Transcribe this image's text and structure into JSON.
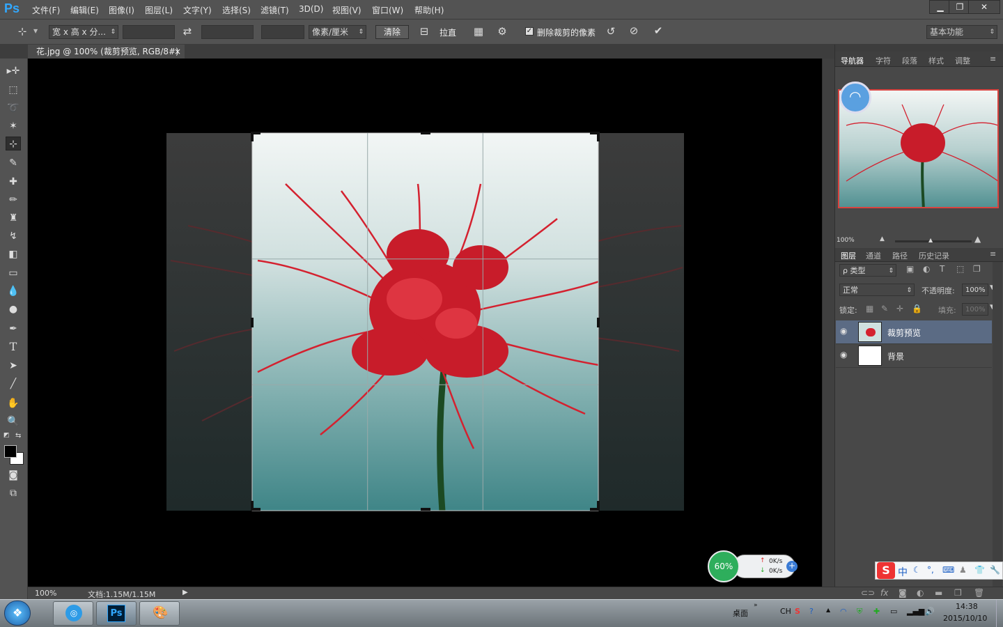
{
  "menubar": {
    "logo": "Ps",
    "items": [
      "文件(F)",
      "编辑(E)",
      "图像(I)",
      "图层(L)",
      "文字(Y)",
      "选择(S)",
      "滤镜(T)",
      "3D(D)",
      "视图(V)",
      "窗口(W)",
      "帮助(H)"
    ]
  },
  "optbar": {
    "ratio_select": "宽 x 高 x 分...",
    "unit_select": "像素/厘米",
    "clear_label": "清除",
    "straighten_label": "拉直",
    "delete_pixels_label": "删除裁剪的像素",
    "workspace": "基本功能"
  },
  "document": {
    "tab_title": "花.jpg @ 100% (裁剪预览, RGB/8#)",
    "close": "×"
  },
  "status": {
    "zoom": "100%",
    "doc_info": "文档:1.15M/1.15M"
  },
  "navigator": {
    "tabs": [
      "导航器",
      "字符",
      "段落",
      "样式",
      "调整"
    ],
    "zoom": "100%"
  },
  "layers_panel": {
    "tabs": [
      "图层",
      "通道",
      "路径",
      "历史记录"
    ],
    "kind": "ρ 类型",
    "blend_mode": "正常",
    "opacity_label": "不透明度:",
    "opacity": "100%",
    "lock_label": "锁定:",
    "fill_label": "填充:",
    "fill": "100%",
    "layers": [
      {
        "name": "裁剪预览"
      },
      {
        "name": "背景"
      }
    ]
  },
  "netmeter": {
    "percent": "60%",
    "up": "0K/s",
    "down": "0K/s"
  },
  "ime": {
    "mode": "中"
  },
  "taskbar": {
    "desktop": "桌面",
    "lang": "CH",
    "time": "14:38",
    "date": "2015/10/10"
  },
  "colors": {
    "accent": "#31a8ff",
    "selected_layer": "#5b6b84",
    "flower": "#d4212f"
  }
}
